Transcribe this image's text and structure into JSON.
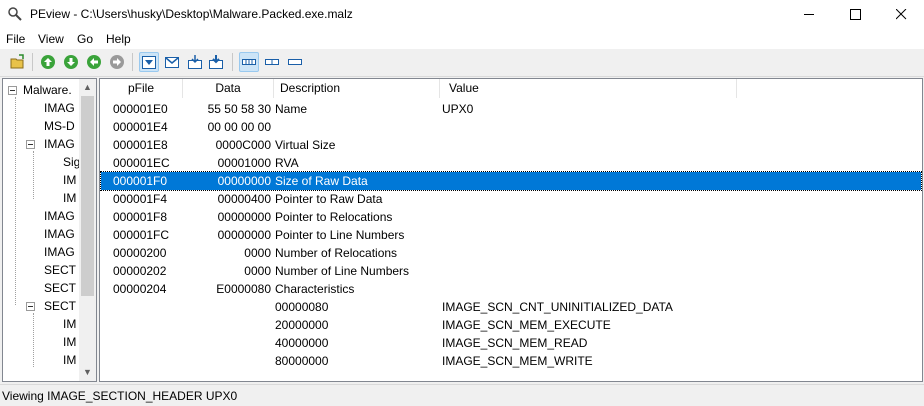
{
  "window": {
    "title": "PEview - C:\\Users\\husky\\Desktop\\Malware.Packed.exe.malz"
  },
  "menu": [
    "File",
    "View",
    "Go",
    "Help"
  ],
  "toolbar": {
    "buttons": [
      "open-icon",
      "arrow-up-icon",
      "arrow-down-icon",
      "arrow-left-icon",
      "arrow-right-icon",
      "view-byte-icon",
      "view-word-icon",
      "view-dword-icon",
      "view-qword-icon",
      "layout-1-icon",
      "layout-2-icon",
      "layout-3-icon"
    ]
  },
  "tree": {
    "items": [
      {
        "label": "Malware."
      },
      {
        "label": "IMAG"
      },
      {
        "label": "MS-D"
      },
      {
        "label": "IMAG"
      },
      {
        "label": "Sig"
      },
      {
        "label": "IM"
      },
      {
        "label": "IM"
      },
      {
        "label": "IMAG"
      },
      {
        "label": "IMAG"
      },
      {
        "label": "IMAG"
      },
      {
        "label": "SECT"
      },
      {
        "label": "SECT"
      },
      {
        "label": "SECT"
      },
      {
        "label": "IM"
      },
      {
        "label": "IM"
      },
      {
        "label": "IM"
      }
    ]
  },
  "table": {
    "headers": {
      "pfile": "pFile",
      "data": "Data",
      "description": "Description",
      "value": "Value"
    },
    "rows": [
      {
        "pfile": "000001E0",
        "data": "55  50  58  30",
        "description": "Name",
        "value": "UPX0"
      },
      {
        "pfile": "000001E4",
        "data": "00  00  00  00",
        "description": "",
        "value": ""
      },
      {
        "pfile": "000001E8",
        "data": "0000C000",
        "description": "Virtual Size",
        "value": ""
      },
      {
        "pfile": "000001EC",
        "data": "00001000",
        "description": "RVA",
        "value": ""
      },
      {
        "pfile": "000001F0",
        "data": "00000000",
        "description": "Size of Raw Data",
        "value": ""
      },
      {
        "pfile": "000001F4",
        "data": "00000400",
        "description": "Pointer to Raw Data",
        "value": ""
      },
      {
        "pfile": "000001F8",
        "data": "00000000",
        "description": "Pointer to Relocations",
        "value": ""
      },
      {
        "pfile": "000001FC",
        "data": "00000000",
        "description": "Pointer to Line Numbers",
        "value": ""
      },
      {
        "pfile": "00000200",
        "data": "0000",
        "description": "Number of Relocations",
        "value": ""
      },
      {
        "pfile": "00000202",
        "data": "0000",
        "description": "Number of Line Numbers",
        "value": ""
      },
      {
        "pfile": "00000204",
        "data": "E0000080",
        "description": "Characteristics",
        "value": ""
      },
      {
        "pfile": "",
        "data": "",
        "description": "00000080",
        "value": "IMAGE_SCN_CNT_UNINITIALIZED_DATA"
      },
      {
        "pfile": "",
        "data": "",
        "description": "20000000",
        "value": "IMAGE_SCN_MEM_EXECUTE"
      },
      {
        "pfile": "",
        "data": "",
        "description": "40000000",
        "value": "IMAGE_SCN_MEM_READ"
      },
      {
        "pfile": "",
        "data": "",
        "description": "80000000",
        "value": "IMAGE_SCN_MEM_WRITE"
      }
    ]
  },
  "selected_row": "000001F0",
  "status": "Viewing IMAGE_SECTION_HEADER UPX0",
  "colors": {
    "selection": "#0078d7",
    "toolbar_active": "#cce4f7"
  }
}
